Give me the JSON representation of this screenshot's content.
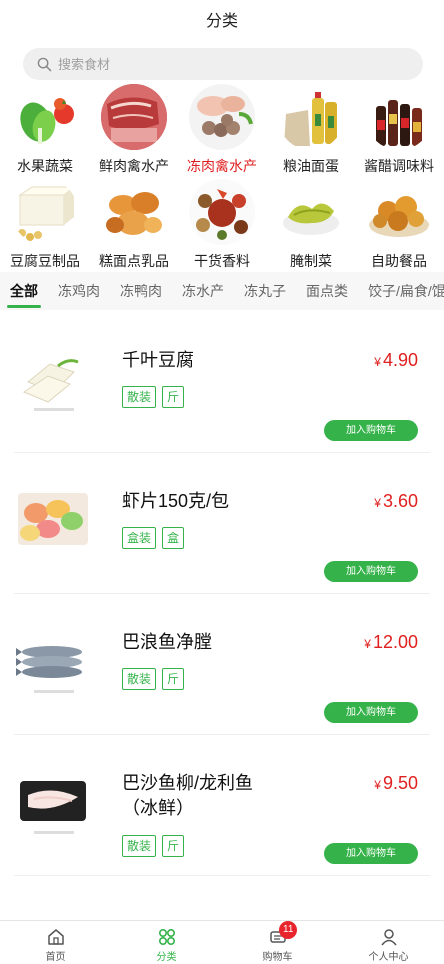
{
  "header": {
    "title": "分类"
  },
  "search": {
    "placeholder": "搜索食材"
  },
  "categories": [
    {
      "label": "水果蔬菜",
      "icon": "vegetables-icon"
    },
    {
      "label": "鲜肉禽水产",
      "icon": "fresh-meat-icon"
    },
    {
      "label": "冻肉禽水产",
      "icon": "frozen-meat-icon",
      "active": true
    },
    {
      "label": "粮油面蛋",
      "icon": "grain-oil-icon"
    },
    {
      "label": "酱醋调味料",
      "icon": "condiments-icon"
    },
    {
      "label": "豆腐豆制品",
      "icon": "tofu-icon"
    },
    {
      "label": "糕面点乳品",
      "icon": "pastry-dairy-icon"
    },
    {
      "label": "干货香料",
      "icon": "dried-spices-icon"
    },
    {
      "label": "腌制菜",
      "icon": "pickled-vegetables-icon"
    },
    {
      "label": "自助餐品",
      "icon": "buffet-food-icon"
    }
  ],
  "subtabs": [
    "全部",
    "冻鸡肉",
    "冻鸭肉",
    "冻水产",
    "冻丸子",
    "面点类",
    "饺子/扁食/馄饨"
  ],
  "active_subtab": "全部",
  "products": [
    {
      "name": "千叶豆腐",
      "tags": [
        "散装",
        "斤"
      ],
      "currency": "¥",
      "price": "4.90",
      "cart_label": "加入购物车"
    },
    {
      "name": "虾片150克/包",
      "tags": [
        "盒装",
        "盒"
      ],
      "currency": "¥",
      "price": "3.60",
      "cart_label": "加入购物车"
    },
    {
      "name": "巴浪鱼净膛",
      "tags": [
        "散装",
        "斤"
      ],
      "currency": "¥",
      "price": "12.00",
      "cart_label": "加入购物车"
    },
    {
      "name": "巴沙鱼柳/龙利鱼（冰鲜）",
      "tags": [
        "散装",
        "斤"
      ],
      "currency": "¥",
      "price": "9.50",
      "cart_label": "加入购物车"
    }
  ],
  "tabbar": {
    "home": "首页",
    "category": "分类",
    "cart": "购物车",
    "cart_badge": "11",
    "profile": "个人中心",
    "active": "分类"
  },
  "colors": {
    "accent": "#35b34a",
    "price": "#e02020",
    "badge": "#e8242c"
  }
}
